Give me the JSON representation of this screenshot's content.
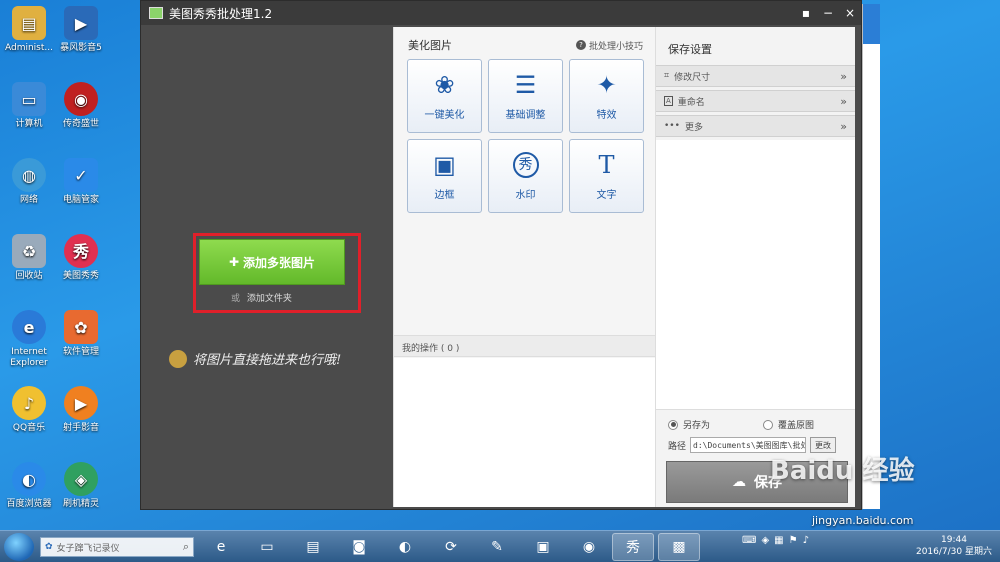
{
  "desktop": {
    "icons": [
      {
        "label": "Administ...",
        "icon": "user-folder-icon",
        "color": "#e0b040"
      },
      {
        "label": "计算机",
        "icon": "computer-icon",
        "color": "#3a8ad8"
      },
      {
        "label": "网络",
        "icon": "network-icon",
        "color": "#3a9ad8"
      },
      {
        "label": "回收站",
        "icon": "recycle-bin-icon",
        "color": "#9ab"
      },
      {
        "label": "Internet Explorer",
        "icon": "ie-icon",
        "color": "#2a7ad8"
      },
      {
        "label": "QQ音乐",
        "icon": "qq-music-icon",
        "color": "#f0c030"
      },
      {
        "label": "百度浏览器",
        "icon": "baidu-browser-icon",
        "color": "#2a8ae8"
      },
      {
        "label": "暴风影音5",
        "icon": "baofeng-icon",
        "color": "#2a6ab8"
      },
      {
        "label": "传奇盛世",
        "icon": "game-icon",
        "color": "#c02020"
      },
      {
        "label": "电脑管家",
        "icon": "pc-manager-icon",
        "color": "#2a8ae8"
      },
      {
        "label": "美图秀秀",
        "icon": "meitu-icon",
        "color": "#e03050"
      },
      {
        "label": "软件管理",
        "icon": "software-manager-icon",
        "color": "#e86a30"
      },
      {
        "label": "射手影音",
        "icon": "player-icon",
        "color": "#f08020"
      },
      {
        "label": "刷机精灵",
        "icon": "flash-tool-icon",
        "color": "#30a060"
      }
    ]
  },
  "window": {
    "title": "美图秀秀批处理1.2",
    "controls": {
      "menu": "▪",
      "minimize": "−",
      "close": "×"
    }
  },
  "dropzone": {
    "add_images": "添加多张图片",
    "add_plus": "✚",
    "or": "或",
    "add_folder": "添加文件夹",
    "drag_hint": "将图片直接拖进来也行哦!"
  },
  "beautify": {
    "title": "美化图片",
    "tips": "批处理小技巧",
    "tools": [
      {
        "label": "一键美化",
        "icon": "tulip-icon",
        "glyph": "❀"
      },
      {
        "label": "基础调整",
        "icon": "sliders-icon",
        "glyph": "☰"
      },
      {
        "label": "特效",
        "icon": "magic-wand-icon",
        "glyph": "✦"
      },
      {
        "label": "边框",
        "icon": "frame-icon",
        "glyph": "▣"
      },
      {
        "label": "水印",
        "icon": "watermark-stamp-icon",
        "glyph": "秀"
      },
      {
        "label": "文字",
        "icon": "text-icon",
        "glyph": "T"
      }
    ],
    "ops_label": "我的操作 ( 0 )"
  },
  "save": {
    "title": "保存设置",
    "sections": [
      {
        "label": "修改尺寸",
        "icon": "crop-icon",
        "glyph": "⌗"
      },
      {
        "label": "重命名",
        "icon": "rename-icon",
        "glyph": "A"
      },
      {
        "label": "更多",
        "icon": "more-icon",
        "glyph": "•••"
      }
    ],
    "save_as": "另存为",
    "overwrite": "覆盖原图",
    "path_label": "路径",
    "path_value": "d:\\Documents\\美图图库\\批处理",
    "change": "更改",
    "save_button": "保存"
  },
  "taskbar": {
    "search_placeholder": "女子蹿飞记录仪",
    "clock_time": "19:44",
    "clock_date": "2016/7/30 星期六"
  },
  "watermark": {
    "brand": "Baidu 经验",
    "url": "jingyan.baidu.com"
  }
}
